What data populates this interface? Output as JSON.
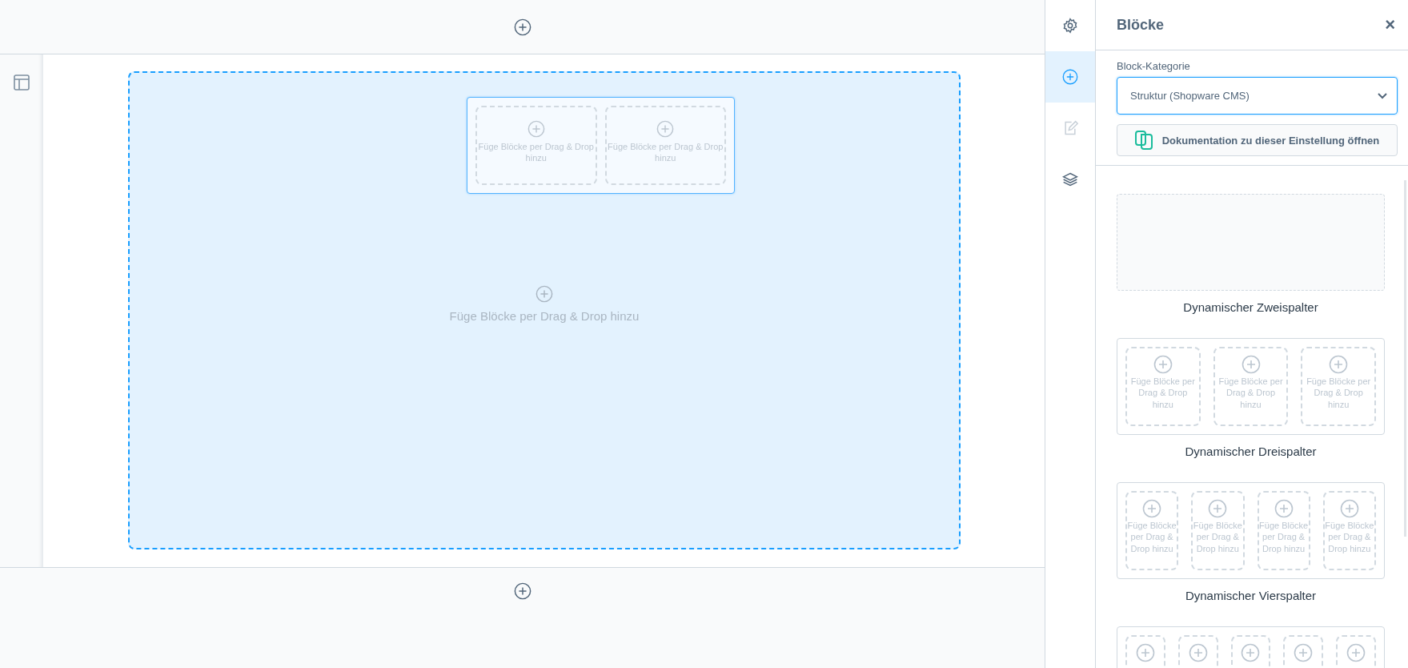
{
  "canvas": {
    "drop_text": "Füge Blöcke per Drag & Drop hinzu",
    "block": {
      "selected": true,
      "slots": [
        {
          "kind": "slot",
          "text": "Füge Blöcke per Drag & Drop hinzu"
        },
        {
          "kind": "slot",
          "text": "Füge Blöcke per Drag & Drop hinzu"
        }
      ]
    }
  },
  "sidebar_tabs": [
    {
      "kind": "settings",
      "selected": false,
      "disabled": false
    },
    {
      "kind": "add",
      "selected": true,
      "disabled": false
    },
    {
      "kind": "edit",
      "selected": false,
      "disabled": true
    },
    {
      "kind": "layers",
      "selected": false,
      "disabled": false
    }
  ],
  "panel": {
    "title": "Blöcke",
    "close": "×",
    "category_label": "Block-Kategorie",
    "category_value": "Struktur (Shopware CMS)",
    "doc_button": "Dokumentation zu dieser Einstellung öffnen",
    "blocks": [
      {
        "kind": "empty",
        "label": "Dynamischer Zweispalter"
      },
      {
        "kind": "columns",
        "label": "Dynamischer Dreispalter",
        "slots": [
          {
            "kind": "slot",
            "text": "Füge Blöcke per Drag & Drop hinzu"
          },
          {
            "kind": "slot",
            "text": "Füge Blöcke per Drag & Drop hinzu"
          },
          {
            "kind": "slot",
            "text": "Füge Blöcke per Drag & Drop hinzu"
          }
        ]
      },
      {
        "kind": "columns",
        "label": "Dynamischer Vierspalter",
        "slots": [
          {
            "kind": "slot",
            "text": "Füge Blöcke per Drag & Drop hinzu"
          },
          {
            "kind": "slot",
            "text": "Füge Blöcke per Drag & Drop hinzu"
          },
          {
            "kind": "slot",
            "text": "Füge Blöcke per Drag & Drop hinzu"
          },
          {
            "kind": "slot",
            "text": "Füge Blöcke per Drag & Drop hinzu"
          }
        ]
      },
      {
        "kind": "columns",
        "slots": [
          {
            "kind": "slot"
          },
          {
            "kind": "slot"
          },
          {
            "kind": "slot"
          },
          {
            "kind": "slot"
          },
          {
            "kind": "slot"
          }
        ]
      }
    ]
  }
}
